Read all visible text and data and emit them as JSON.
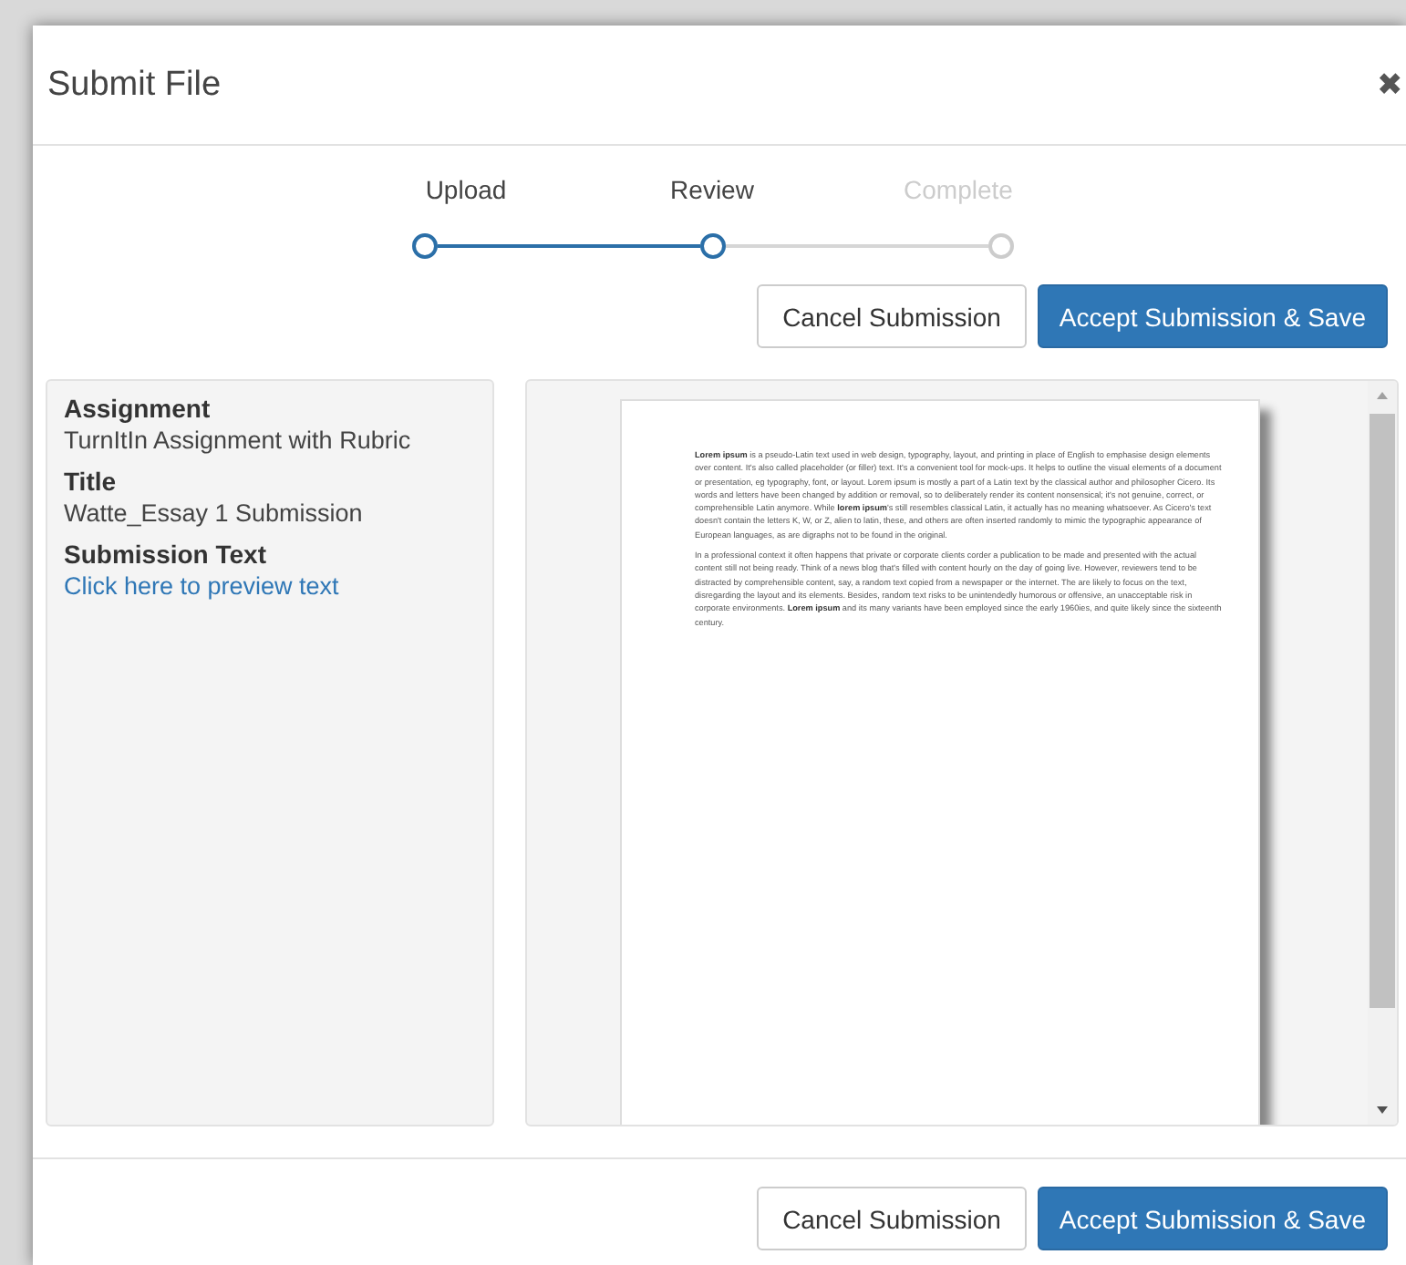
{
  "dialog": {
    "title": "Submit File",
    "close": "✖"
  },
  "steps": [
    {
      "label": "Upload",
      "active": true
    },
    {
      "label": "Review",
      "active": true
    },
    {
      "label": "Complete",
      "active": false
    }
  ],
  "top_buttons": [
    {
      "label": "Cancel Submission",
      "kind": "secondary"
    },
    {
      "label": "Accept Submission & Save",
      "kind": "primary"
    }
  ],
  "details": [
    {
      "label": "Assignment",
      "value": "TurnItIn Assignment with Rubric",
      "kind": "text"
    },
    {
      "label": "Title",
      "value": "Watte_Essay 1 Submission",
      "kind": "text"
    },
    {
      "label": "Submission Text",
      "value": "Click here to preview text",
      "kind": "link"
    }
  ],
  "document": {
    "paragraphs": [
      "**Lorem ipsum** is a pseudo-Latin text used in web design, typography, layout, and printing in place of English to emphasise design elements over content. It's also called placeholder (or filler) text. It's a convenient tool for mock-ups. It helps to outline the visual elements of a document or presentation, eg typography, font, or layout. Lorem ipsum is mostly a part of a Latin text by the classical author and philosopher Cicero. Its words and letters have been changed by addition or removal, so to deliberately render its content nonsensical; it's not genuine, correct, or comprehensible Latin anymore. While **lorem ipsum**'s still resembles classical Latin, it actually has no meaning whatsoever. As Cicero's text doesn't contain the letters K, W, or Z, alien to latin, these, and others are often inserted randomly to mimic the typographic appearance of European languages, as are digraphs not to be found in the original.",
      "In a professional context it often happens that private or corporate clients corder a publication to be made and presented with the actual content still not being ready. Think of a news blog that's filled with content hourly on the day of going live. However, reviewers tend to be distracted by comprehensible content, say, a random text copied from a newspaper or the internet. The are likely to focus on the text, disregarding the layout and its elements. Besides, random text risks to be unintendedly humorous or offensive, an unacceptable risk in corporate environments. **Lorem ipsum** and its many variants have been employed since the early 1960ies, and quite likely since the sixteenth century."
    ]
  },
  "bottom_buttons": [
    {
      "label": "Cancel Submission",
      "kind": "secondary"
    },
    {
      "label": "Accept Submission & Save",
      "kind": "primary"
    }
  ]
}
